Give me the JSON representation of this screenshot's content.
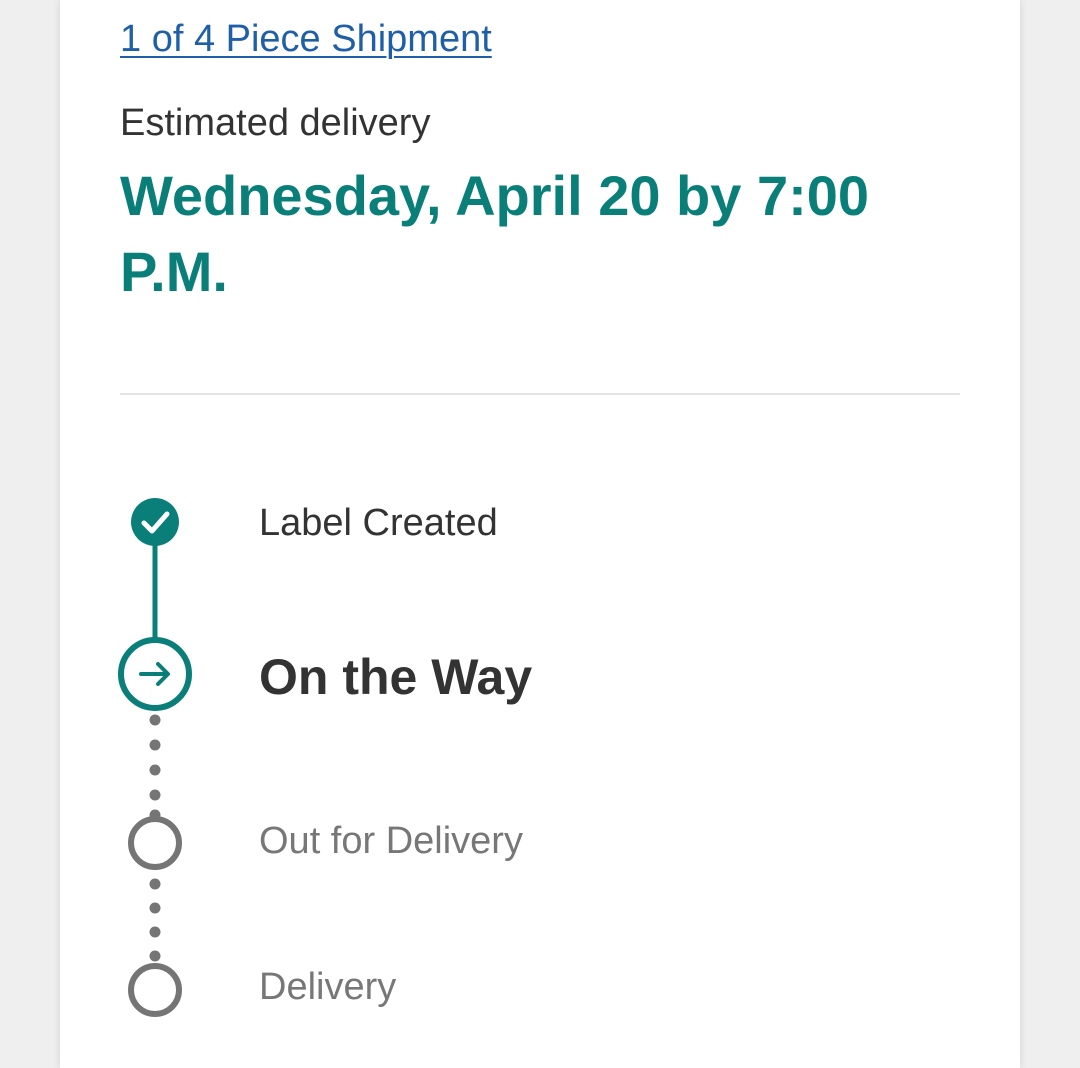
{
  "shipment": {
    "link_text": "1 of 4 Piece Shipment"
  },
  "delivery": {
    "label": "Estimated delivery",
    "value": "Wednesday, April 20 by 7:00 P.M."
  },
  "progress": {
    "steps": [
      {
        "label": "Label Created",
        "status": "completed",
        "icon": "check-icon"
      },
      {
        "label": "On the Way",
        "status": "current",
        "icon": "arrow-right-icon"
      },
      {
        "label": "Out for Delivery",
        "status": "pending",
        "icon": "empty-circle-icon"
      },
      {
        "label": "Delivery",
        "status": "pending",
        "icon": "empty-circle-icon"
      }
    ]
  },
  "colors": {
    "accent": "#0a7f7a",
    "link": "#1f5fa8",
    "text_primary": "#333333",
    "text_muted": "#777777",
    "pending_gray": "#757575",
    "background": "#efefef",
    "card": "#ffffff"
  }
}
